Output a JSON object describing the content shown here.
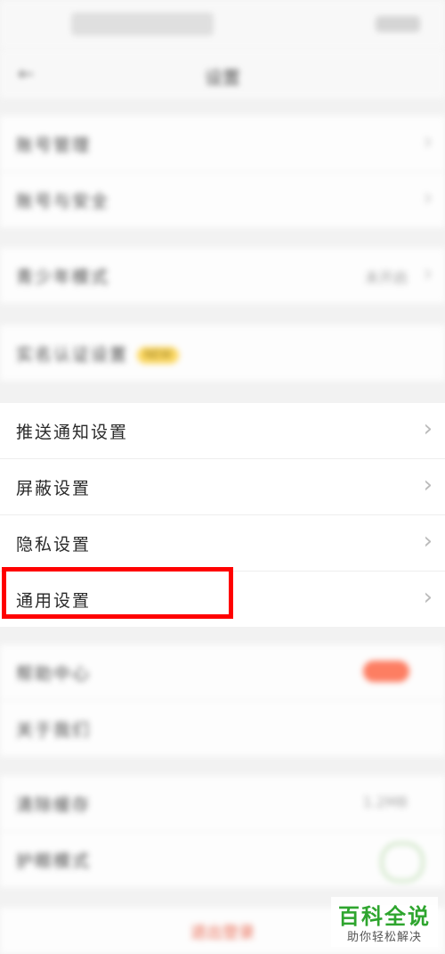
{
  "status_bar": {
    "left": "",
    "right": ""
  },
  "nav": {
    "back_icon": "arrow-left-icon",
    "title": "设置"
  },
  "groups": {
    "account": [
      "账号管理",
      "账号与安全"
    ],
    "mode": {
      "label": "青少年模式",
      "value": "未开启"
    },
    "features": {
      "label": "实名认证设置",
      "badge": "NEW"
    },
    "main": [
      "推送通知设置",
      "屏蔽设置",
      "隐私设置",
      "通用设置"
    ],
    "misc": [
      "帮助中心",
      "关于我们"
    ],
    "cache": {
      "label": "清除缓存",
      "value": "1.2MB"
    },
    "night": {
      "label": "护眼模式"
    }
  },
  "logout": "退出登录",
  "watermark": {
    "title": "百科全说",
    "subtitle": "助你轻松解决"
  },
  "colors": {
    "highlight": "#ff0000",
    "accent": "#e8553a",
    "watermark_green": "#2ea52e"
  }
}
